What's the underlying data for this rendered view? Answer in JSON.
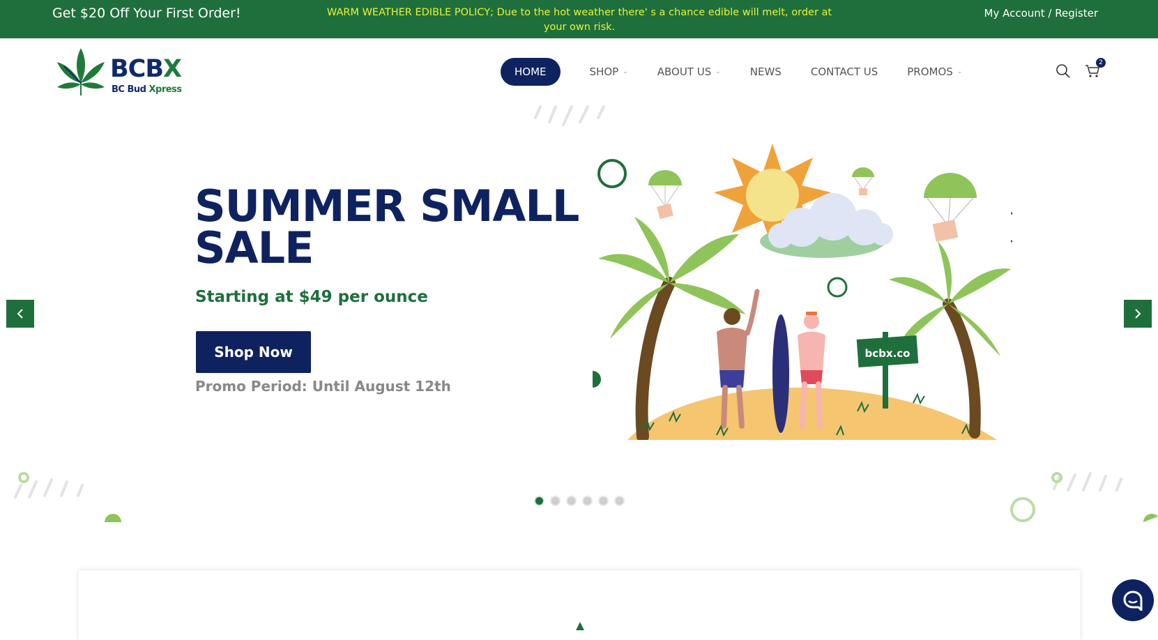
{
  "topbar": {
    "promo": "Get $20 Off Your First Order!",
    "policy": "WARM WEATHER EDIBLE POLICY; Due to the hot weather there' s a chance edible will melt, order at your own risk.",
    "account": "My Account / Register",
    "bg_color": "#1f6f3c",
    "policy_color": "#e9f23a"
  },
  "header": {
    "logo": {
      "brand_left": "BCB",
      "brand_x": "X",
      "sub_left": "BC Bud ",
      "sub_right": "Xpress"
    },
    "nav": [
      {
        "label": "HOME",
        "active": true
      },
      {
        "label": "SHOP",
        "dropdown": true
      },
      {
        "label": "ABOUT US",
        "dropdown": true
      },
      {
        "label": "NEWS"
      },
      {
        "label": "CONTACT US"
      },
      {
        "label": "PROMOS",
        "dropdown": true
      }
    ],
    "cart_count": "2",
    "icons": [
      "search-icon",
      "cart-icon"
    ]
  },
  "hero": {
    "title_line1": "SUMMER SMALL",
    "title_line2": "SALE",
    "subtitle": "Starting at $49 per ounce",
    "cta": "Shop Now",
    "period": "Promo Period: Until August 12th",
    "sign_text": "bcbx.co",
    "slides": 6,
    "active_slide": 1
  },
  "colors": {
    "navy": "#0f2260",
    "green": "#1f6f3c"
  }
}
